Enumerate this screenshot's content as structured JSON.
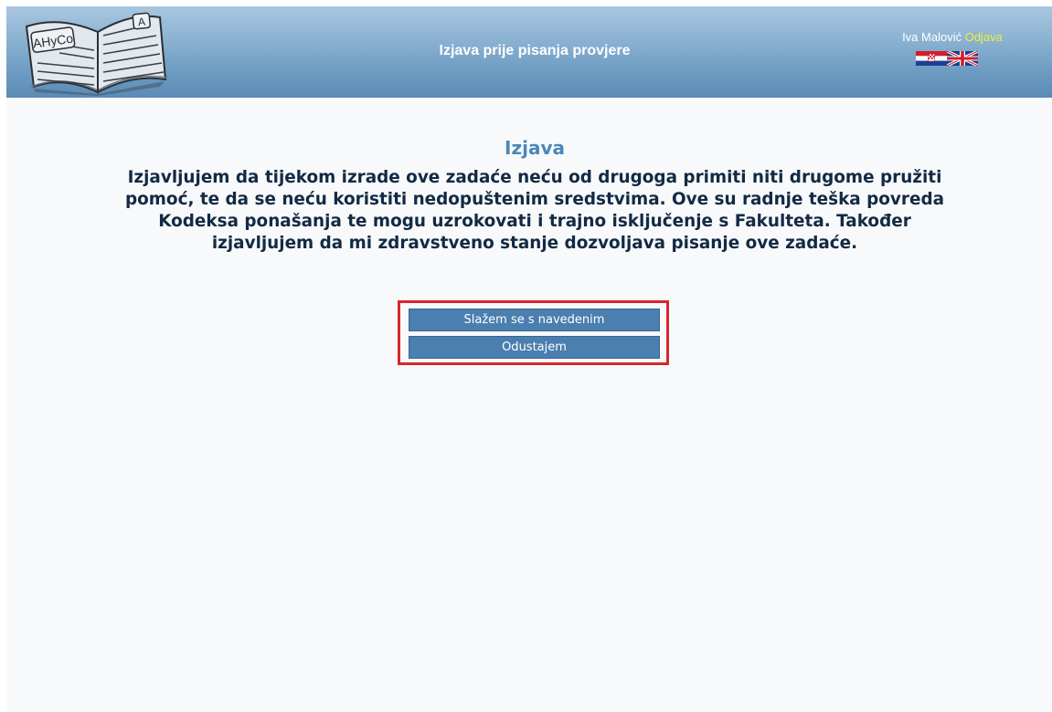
{
  "header": {
    "title": "Izjava prije pisanja provjere",
    "logo_text": "AHyCo",
    "logo_tab": "A",
    "user_name": "Iva Malović",
    "logout_label": "Odjava",
    "flags": [
      "hr-flag-icon",
      "uk-flag-icon"
    ]
  },
  "main": {
    "title": "Izjava",
    "statement": "Izjavljujem da tijekom izrade ove zadaće neću od drugoga primiti niti drugome pružiti pomoć, te da se neću koristiti nedopuštenim sredstvima. Ove su radnje teška povreda Kodeksa ponašanja te mogu uzrokovati i trajno isključenje s Fakulteta. Također izjavljujem da mi zdravstveno stanje dozvoljava pisanje ove zadaće.",
    "agree_label": "Slažem se s navedenim",
    "cancel_label": "Odustajem"
  },
  "colors": {
    "accent": "#4b87b9",
    "button": "#4a7faf",
    "statement_text": "#122a44",
    "logout_link": "#f1ee38",
    "highlight": "#d8252e"
  }
}
